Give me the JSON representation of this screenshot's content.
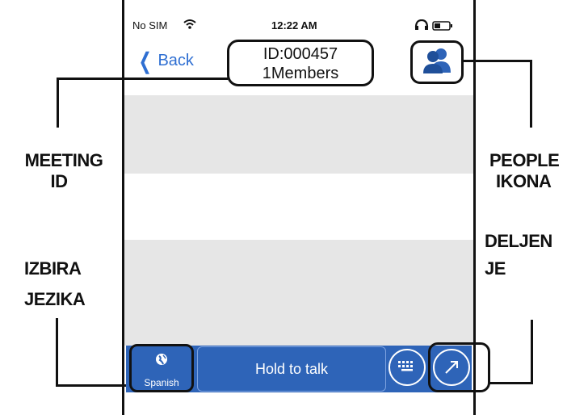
{
  "status_bar": {
    "carrier": "No SIM",
    "time": "12:22 AM"
  },
  "nav": {
    "back_label": "Back",
    "meeting_id": "ID:000457",
    "members": "1Members"
  },
  "annotations": {
    "meeting_id": [
      "MEETING",
      "ID"
    ],
    "people_icon": [
      "PEOPLE",
      "IKONA"
    ],
    "language": [
      "IZBIRA",
      "JEZIKA"
    ],
    "share": [
      "DELJEN",
      "JE"
    ]
  },
  "bottom_bar": {
    "language_label": "Spanish",
    "hold_to_talk": "Hold to talk"
  },
  "colors": {
    "accent": "#2e64b8",
    "link": "#2f6fd2",
    "panel": "#e6e6e6"
  },
  "icons": [
    "wifi-icon",
    "headphones-icon",
    "battery-icon",
    "people-icon",
    "globe-icon",
    "keyboard-icon",
    "share-icon"
  ]
}
